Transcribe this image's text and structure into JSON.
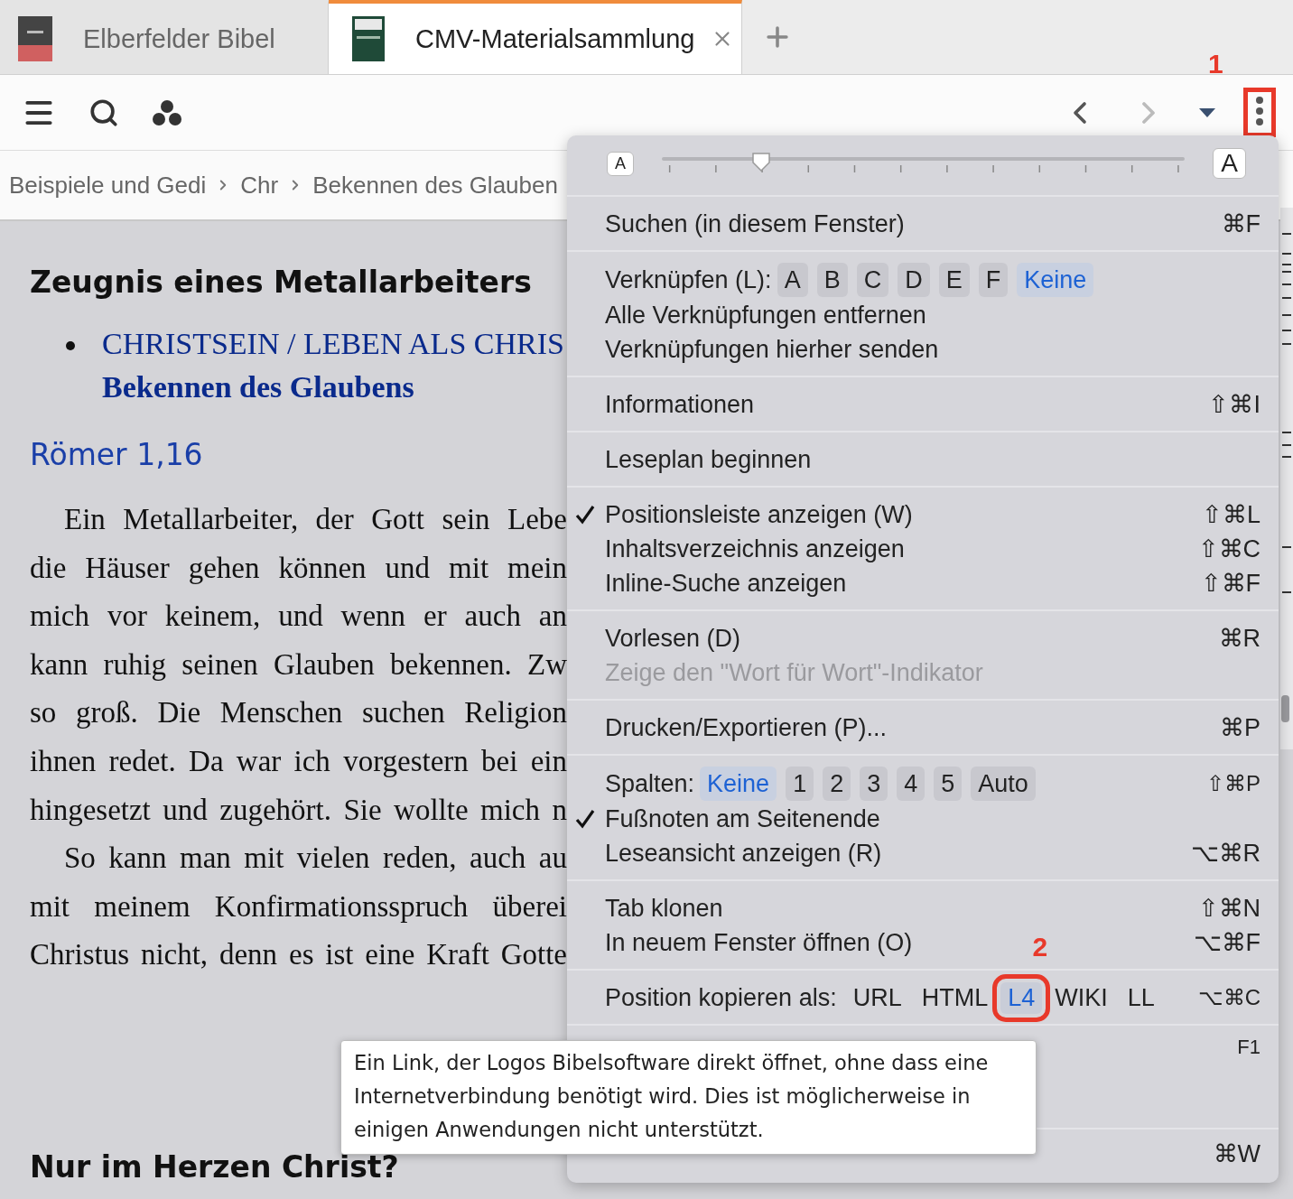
{
  "tabs": [
    {
      "label": "Elberfelder Bibel",
      "selected": false
    },
    {
      "label": "CMV-Materialsammlung",
      "selected": true
    }
  ],
  "toolbar": {
    "more_annotation": "1"
  },
  "breadcrumb": [
    "Beispiele und Gedi",
    "Chr",
    "Bekennen des Glauben"
  ],
  "article": {
    "heading": "Zeugnis eines Metallarbeiters",
    "bullet_links": [
      "CHRISTSEIN / LEBEN ALS CHRIS",
      "Bekennen des Glaubens"
    ],
    "reference": "Römer 1,16",
    "lines": [
      {
        "text": "Ein Metallarbeiter, der Gott sein Lebe",
        "indent": true
      },
      {
        "text": "die Häuser gehen können und mit mein",
        "indent": false
      },
      {
        "text": "mich vor keinem, und wenn er auch an",
        "indent": false
      },
      {
        "text": "kann ruhig seinen Glauben bekennen. Zw",
        "indent": false
      },
      {
        "text": "so groß. Die Menschen suchen Religion",
        "indent": false
      },
      {
        "text": "ihnen redet. Da war ich vorgestern bei ein",
        "indent": false
      },
      {
        "text": "hingesetzt und zugehört. Sie wollte mich n",
        "indent": false
      },
      {
        "text": "So kann man mit vielen reden, auch au",
        "indent": true
      },
      {
        "text": "mit meinem Konfirmationsspruch überei",
        "indent": false
      },
      {
        "text": "Christus nicht, denn es ist eine Kraft Gotte",
        "indent": false
      }
    ],
    "next_heading": "Nur im Herzen Christ?"
  },
  "menu": {
    "font_size": {
      "small_label": "A",
      "large_label": "A",
      "level": 0.19
    },
    "sections": [
      [
        {
          "kind": "item",
          "label": "Suchen (in diesem Fenster)",
          "shortcut": "⌘F",
          "checked": false,
          "disabled": false
        }
      ],
      [
        {
          "kind": "choices",
          "label": "Verknüpfen (L):",
          "options": [
            {
              "label": "A",
              "selected": false
            },
            {
              "label": "B",
              "selected": false
            },
            {
              "label": "C",
              "selected": false
            },
            {
              "label": "D",
              "selected": false
            },
            {
              "label": "E",
              "selected": false
            },
            {
              "label": "F",
              "selected": false
            },
            {
              "label": "Keine",
              "selected": true
            }
          ]
        },
        {
          "kind": "item",
          "label": "Alle Verknüpfungen entfernen",
          "checked": false,
          "disabled": false
        },
        {
          "kind": "item",
          "label": "Verknüpfungen hierher senden",
          "checked": false,
          "disabled": false
        }
      ],
      [
        {
          "kind": "item",
          "label": "Informationen",
          "shortcut": "⇧⌘I",
          "checked": false,
          "disabled": false
        }
      ],
      [
        {
          "kind": "item",
          "label": "Leseplan beginnen",
          "checked": false,
          "disabled": false
        }
      ],
      [
        {
          "kind": "item",
          "label": "Positionsleiste anzeigen (W)",
          "shortcut": "⇧⌘L",
          "checked": true,
          "disabled": false
        },
        {
          "kind": "item",
          "label": "Inhaltsverzeichnis anzeigen",
          "shortcut": "⇧⌘C",
          "checked": false,
          "disabled": false
        },
        {
          "kind": "item",
          "label": "Inline-Suche anzeigen",
          "shortcut": "⇧⌘F",
          "checked": false,
          "disabled": false
        }
      ],
      [
        {
          "kind": "item",
          "label": "Vorlesen (D)",
          "shortcut": "⌘R",
          "checked": false,
          "disabled": false
        },
        {
          "kind": "item",
          "label": "Zeige den \"Wort für Wort\"-Indikator",
          "checked": false,
          "disabled": true
        }
      ],
      [
        {
          "kind": "item",
          "label": "Drucken/Exportieren (P)...",
          "shortcut": "⌘P",
          "checked": false,
          "disabled": false
        }
      ],
      [
        {
          "kind": "choices",
          "label": "Spalten:",
          "shortcut": "⇧⌘P",
          "options": [
            {
              "label": "Keine",
              "selected": true
            },
            {
              "label": "1",
              "selected": false
            },
            {
              "label": "2",
              "selected": false
            },
            {
              "label": "3",
              "selected": false
            },
            {
              "label": "4",
              "selected": false
            },
            {
              "label": "5",
              "selected": false
            },
            {
              "label": "Auto",
              "selected": false
            }
          ]
        },
        {
          "kind": "item",
          "label": "Fußnoten am Seitenende",
          "checked": true,
          "disabled": false
        },
        {
          "kind": "item",
          "label": "Leseansicht anzeigen (R)",
          "shortcut": "⌥⌘R",
          "checked": false,
          "disabled": false
        }
      ],
      [
        {
          "kind": "item",
          "label": "Tab klonen",
          "shortcut": "⇧⌘N",
          "checked": false,
          "disabled": false
        },
        {
          "kind": "item",
          "label": "In neuem Fenster öffnen (O)",
          "shortcut": "⌥⌘F",
          "checked": false,
          "disabled": false
        }
      ],
      [
        {
          "kind": "links",
          "label": "Position kopieren als:",
          "shortcut": "⌥⌘C",
          "options": [
            {
              "label": "URL",
              "selected": false
            },
            {
              "label": "HTML",
              "selected": false
            },
            {
              "label": "L4",
              "selected": true,
              "annotation": "2"
            },
            {
              "label": "WIKI",
              "selected": false
            },
            {
              "label": "LL",
              "selected": false
            }
          ]
        }
      ],
      [
        {
          "kind": "covered",
          "shortcut": "F1"
        }
      ],
      [
        {
          "kind": "item",
          "shortcut": "⌘W",
          "checked": false,
          "disabled": false
        }
      ]
    ]
  },
  "tooltip": "Ein Link, der Logos Bibelsoftware direkt öffnet, ohne dass eine Internetverbindung benötigt wird. Dies ist möglicherweise in einigen Anwendungen nicht unterstützt."
}
